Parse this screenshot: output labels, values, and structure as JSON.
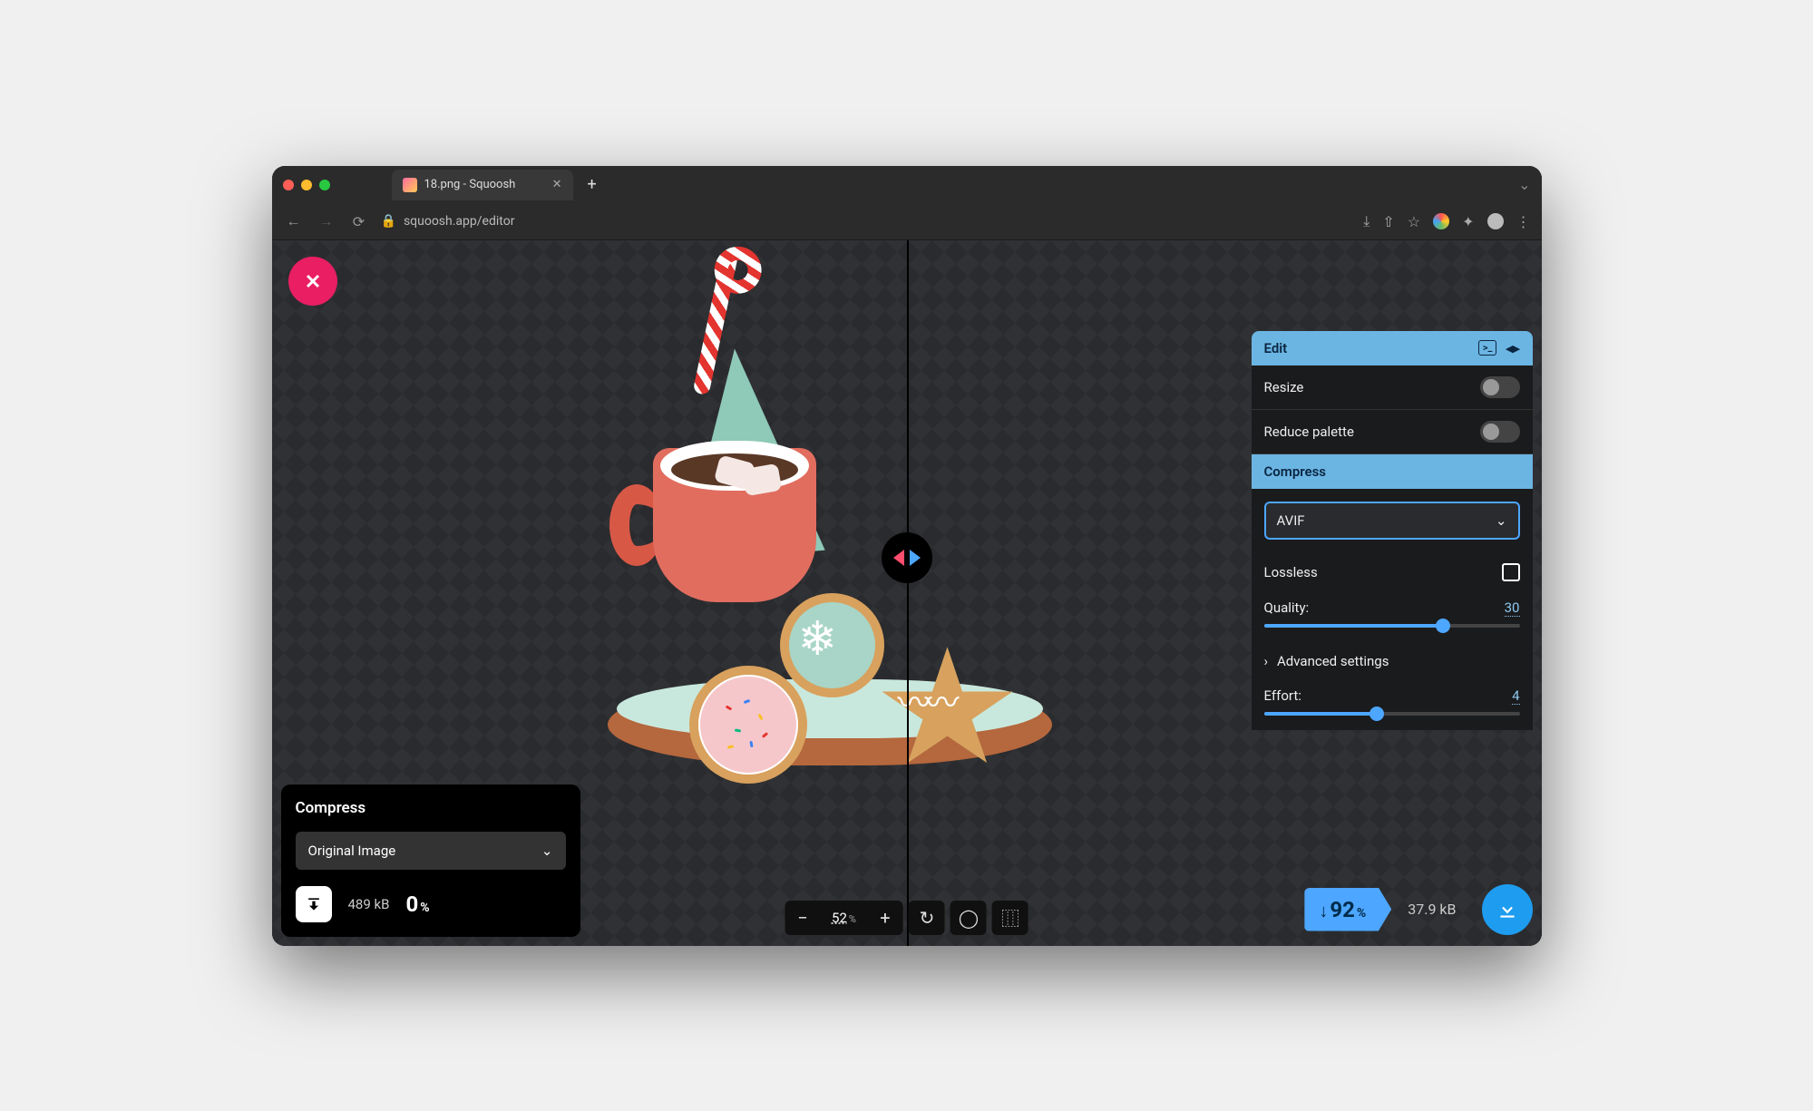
{
  "browser": {
    "tab_title": "18.png - Squoosh",
    "url": "squoosh.app/editor"
  },
  "left_panel": {
    "title": "Compress",
    "format_selected": "Original Image",
    "size": "489",
    "size_unit": "kB",
    "reduction_pct": "0"
  },
  "right_panel": {
    "edit_header": "Edit",
    "resize_label": "Resize",
    "reduce_palette_label": "Reduce palette",
    "compress_header": "Compress",
    "format_selected": "AVIF",
    "lossless_label": "Lossless",
    "quality_label": "Quality:",
    "quality_value": "30",
    "advanced_label": "Advanced settings",
    "effort_label": "Effort:",
    "effort_value": "4"
  },
  "right_stats": {
    "reduction_pct": "92",
    "size": "37.9",
    "size_unit": "kB"
  },
  "zoom": {
    "value": "52"
  }
}
